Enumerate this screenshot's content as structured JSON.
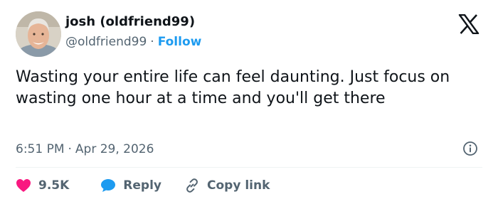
{
  "author": {
    "display_name": "josh (oldfriend99)",
    "handle": "@oldfriend99",
    "separator": "·",
    "follow_label": "Follow",
    "avatar_icon": "profile-photo-avatar"
  },
  "brand": {
    "logo_icon": "x-logo-icon"
  },
  "tweet": {
    "text": "Wasting your entire life can feel daunting. Just focus on wasting one hour at a time and you'll get there"
  },
  "meta": {
    "time": "6:51 PM",
    "separator": "·",
    "date": "Apr 29, 2026",
    "info_icon": "info-icon"
  },
  "actions": {
    "likes_count": "9.5K",
    "reply_label": "Reply",
    "copy_link_label": "Copy link",
    "like_icon": "heart-icon",
    "reply_icon": "speech-bubble-icon",
    "copy_icon": "link-icon"
  },
  "colors": {
    "accent": "#1d9bf0",
    "like": "#f91880",
    "text_primary": "#0f1419",
    "text_secondary": "#536471",
    "divider": "#eff3f4"
  }
}
